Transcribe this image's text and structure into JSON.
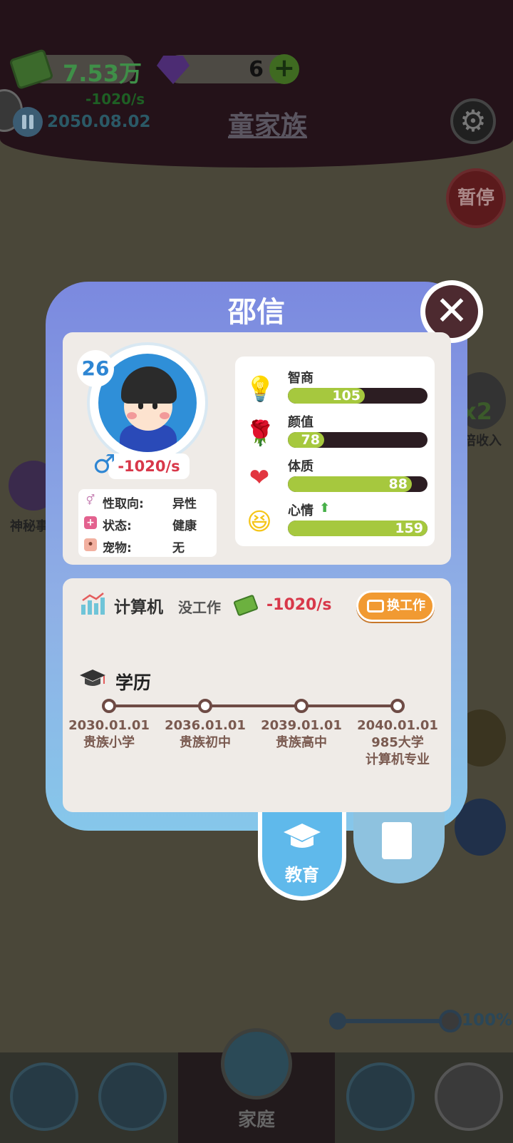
{
  "hud": {
    "money": "7.53万",
    "money_rate": "-1020/s",
    "gems": "6",
    "date": "2050.08.02",
    "family_name": "童家族",
    "pause_label": "暂停",
    "mystery_label": "神秘事",
    "double_income_label": "倍收入",
    "double_badge": "x2",
    "speed": "100%"
  },
  "character": {
    "name": "邵信",
    "age": "26",
    "gender_icon": "♂",
    "income": "-1020/s",
    "info": [
      {
        "icon": "gender-orientation-icon",
        "label": "性取向:",
        "value": "异性"
      },
      {
        "icon": "health-status-icon",
        "label": "状态:",
        "value": "健康"
      },
      {
        "icon": "pet-icon",
        "label": "宠物:",
        "value": "无"
      }
    ],
    "stats": [
      {
        "icon": "lightbulb-icon",
        "label": "智商",
        "value": "105",
        "fill": 0.55
      },
      {
        "icon": "rose-icon",
        "label": "颜值",
        "value": "78",
        "fill": 0.26
      },
      {
        "icon": "heart-icon",
        "label": "体质",
        "value": "88",
        "fill": 0.89
      },
      {
        "icon": "laughing-face-icon",
        "label": "心情",
        "value": "159",
        "fill": 1.0,
        "trend": "up"
      }
    ]
  },
  "job": {
    "major": "计算机",
    "status": "没工作",
    "income": "-1020/s",
    "change_button": "换工作"
  },
  "education": {
    "title": "学历",
    "milestones": [
      {
        "date": "2030.01.01",
        "school": "贵族小学",
        "detail": ""
      },
      {
        "date": "2036.01.01",
        "school": "贵族初中",
        "detail": ""
      },
      {
        "date": "2039.01.01",
        "school": "贵族高中",
        "detail": ""
      },
      {
        "date": "2040.01.01",
        "school": "985大学",
        "detail": "计算机专业"
      }
    ]
  },
  "tabs": {
    "education": "教育"
  },
  "nav": {
    "family": "家庭"
  },
  "colors": {
    "bar_fill": "#a6c83e",
    "bar_track": "#2c1d22",
    "negative": "#d8384a",
    "accent_blue": "#2e86d3"
  }
}
